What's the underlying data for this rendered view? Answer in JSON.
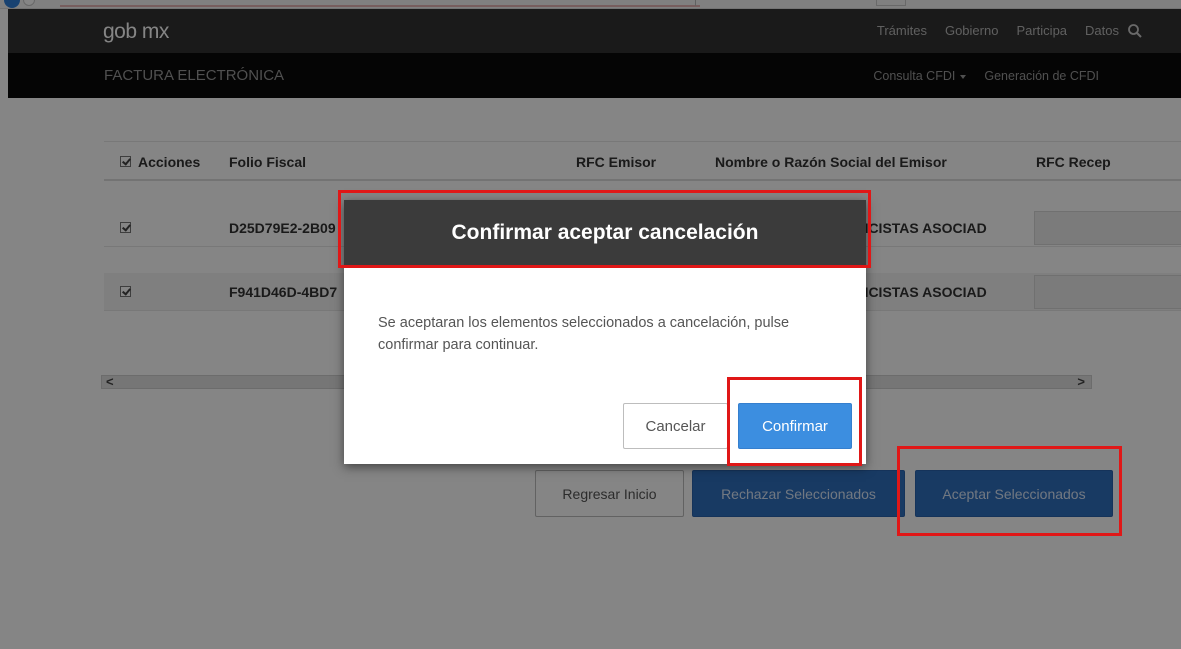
{
  "topbar": {
    "brand": "gob mx",
    "nav": [
      "Trámites",
      "Gobierno",
      "Participa",
      "Datos"
    ],
    "search_icon": "search-icon"
  },
  "subbar": {
    "title": "FACTURA ELECTRÓNICA",
    "nav": [
      "Consulta CFDI",
      "Generación de CFDI"
    ]
  },
  "table": {
    "columns": [
      "Acciones",
      "Folio Fiscal",
      "RFC Emisor",
      "Nombre o Razón Social del Emisor",
      "RFC Recep"
    ],
    "rows": [
      {
        "checked": true,
        "folio": "D25D79E2-2B09",
        "emisor_nombre": "ENCISTAS ASOCIAD"
      },
      {
        "checked": true,
        "folio": "F941D46D-4BD7",
        "emisor_nombre": "ENCISTAS ASOCIAD"
      }
    ],
    "scroll_left": "<",
    "scroll_right": ">"
  },
  "actions": {
    "back": "Regresar Inicio",
    "reject": "Rechazar Seleccionados",
    "accept": "Aceptar Seleccionados"
  },
  "modal": {
    "title": "Confirmar aceptar cancelación",
    "message": "Se aceptaran los elementos seleccionados a cancelación, pulse confirmar para continuar.",
    "cancel": "Cancelar",
    "confirm": "Confirmar"
  },
  "colors": {
    "navbar": "#323232",
    "subbar": "#0a0a0a",
    "primary": "#2f6fbf",
    "confirm": "#3c8ee0",
    "highlight": "#e01717"
  }
}
